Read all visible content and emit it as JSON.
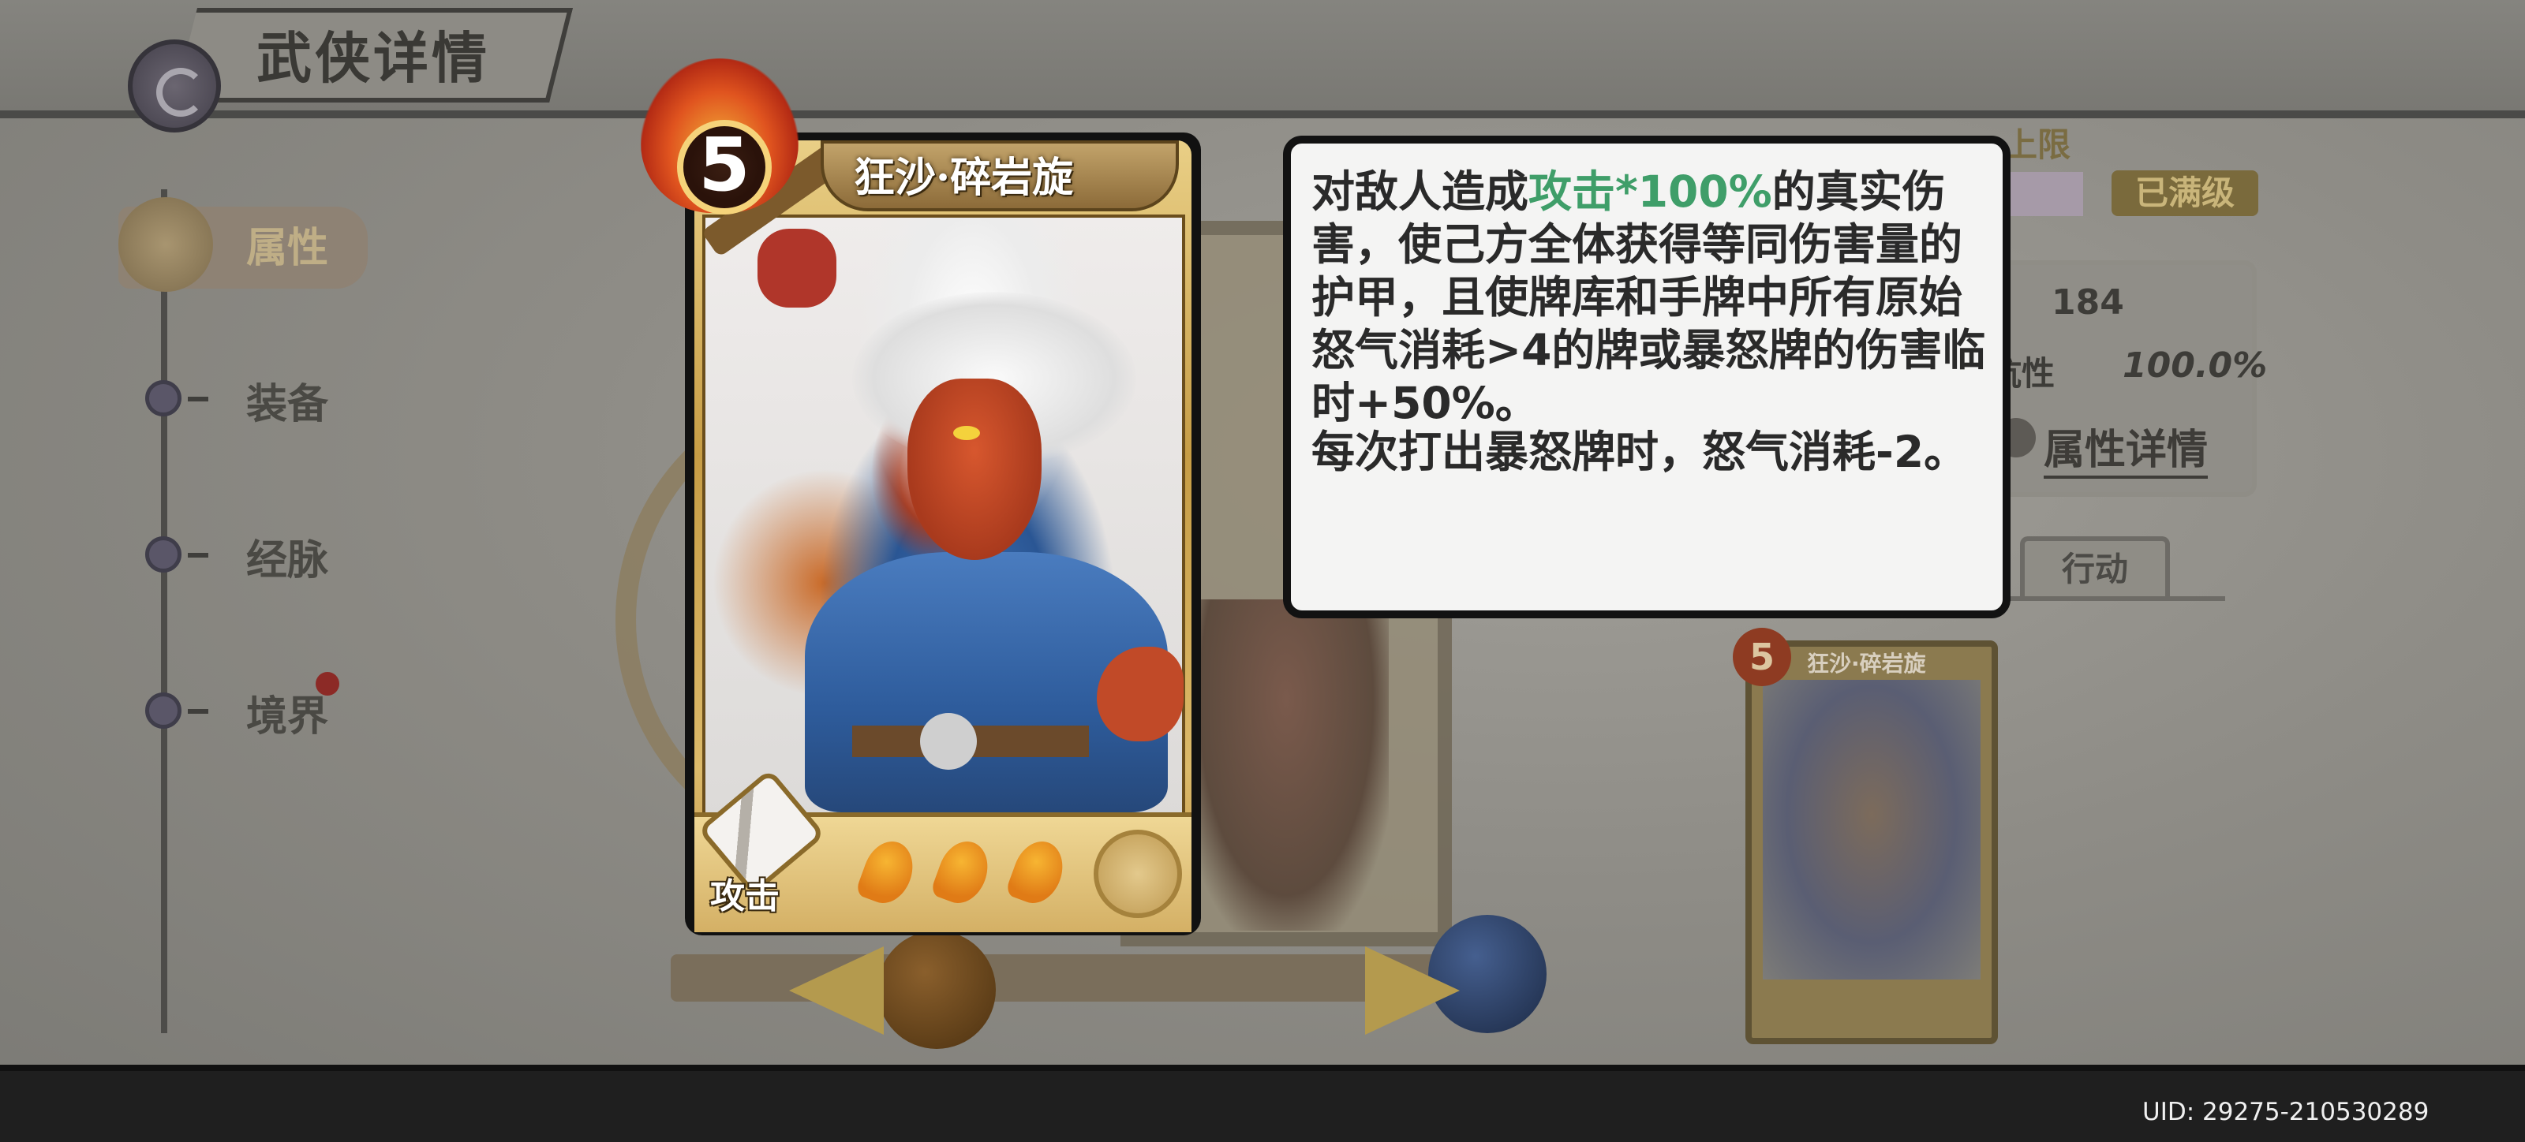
{
  "page": {
    "title": "武侠详情",
    "uid": "UID: 29275-210530289"
  },
  "side_nav": {
    "items": [
      {
        "label": "属性",
        "active": true
      },
      {
        "label": "装备",
        "active": false
      },
      {
        "label": "经脉",
        "active": false
      },
      {
        "label": "境界",
        "active": false,
        "has_notification": true
      }
    ]
  },
  "right_panel": {
    "upper_label": "上限",
    "max_level_badge": "已满级",
    "stat_value_1": "184",
    "stat_label_2": "抗性",
    "stat_value_2": "100.0%",
    "detail_link": "属性详情",
    "tab_action": "行动"
  },
  "mini_card": {
    "cost": "5",
    "name": "狂沙·碎岩旋"
  },
  "card": {
    "cost": "5",
    "name": "狂沙·碎岩旋",
    "type": "攻击",
    "rage_pips": 3,
    "colors": {
      "frame": "#d4b065",
      "flame": "#e0541f",
      "rage_pip": "#f7b532"
    }
  },
  "tooltip": {
    "p1_before": "对敌人造成",
    "p1_highlight": "攻击*100%",
    "p1_after": "的真实伤害，使己方全体获得等同伤害量的护甲，且使牌库和手牌中所有原始怒气消耗>4的牌或暴怒牌的伤害临时+50%。",
    "p2": "每次打出暴怒牌时，怒气消耗-2。",
    "highlight_color": "#3f9e69"
  }
}
